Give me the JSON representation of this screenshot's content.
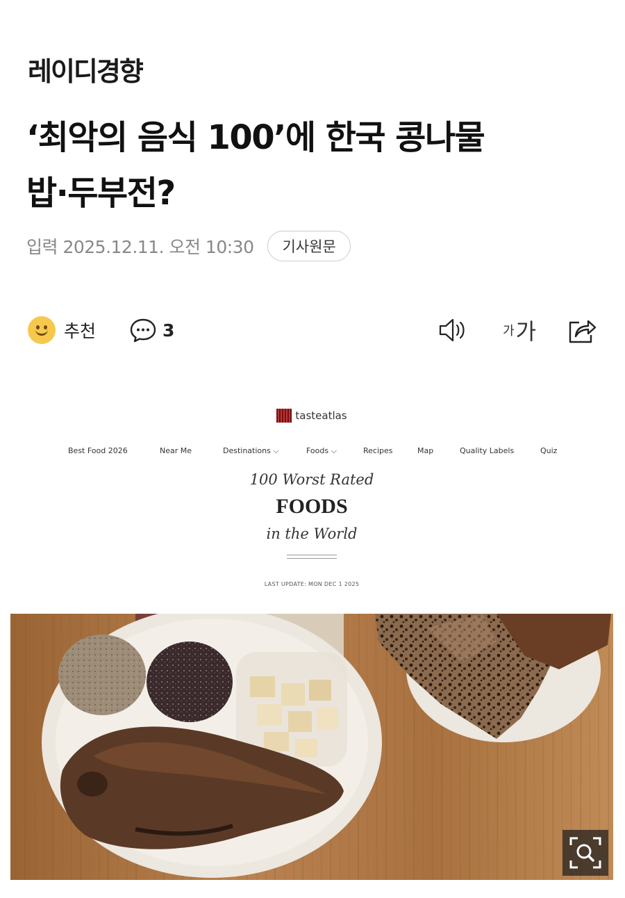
{
  "publisher": "레이디경향",
  "headline": {
    "line1": "‘최악의 음식 100’에 한국 콩나물",
    "line2": "밥·두부전?"
  },
  "meta": {
    "date": "입력 2025.12.11. 오전 10:30",
    "original_button": "기사원문"
  },
  "actions": {
    "like_label": "추천",
    "comment_count": "3",
    "fontsize_small": "가",
    "fontsize_big": "가",
    "icons": [
      "smile-icon",
      "comment-icon",
      "speaker-icon",
      "share-icon"
    ]
  },
  "photo": {
    "site_logo": "tasteatlas",
    "nav": [
      "Best Food 2026",
      "Near Me",
      "Destinations ⌵",
      "Foods ⌵",
      "Recipes",
      "Map",
      "Quality Labels",
      "Quiz"
    ],
    "title_line1": "100 Worst Rated",
    "title_line2": "FOODS",
    "title_line3": "in the World",
    "last_update": "LAST UPDATE: MON DEC 1 2025",
    "zoom_icon": "zoom-icon"
  },
  "colors": {
    "like": "#f6c84c",
    "logo": "#b23a3a",
    "table_wood": "#b07a45"
  }
}
